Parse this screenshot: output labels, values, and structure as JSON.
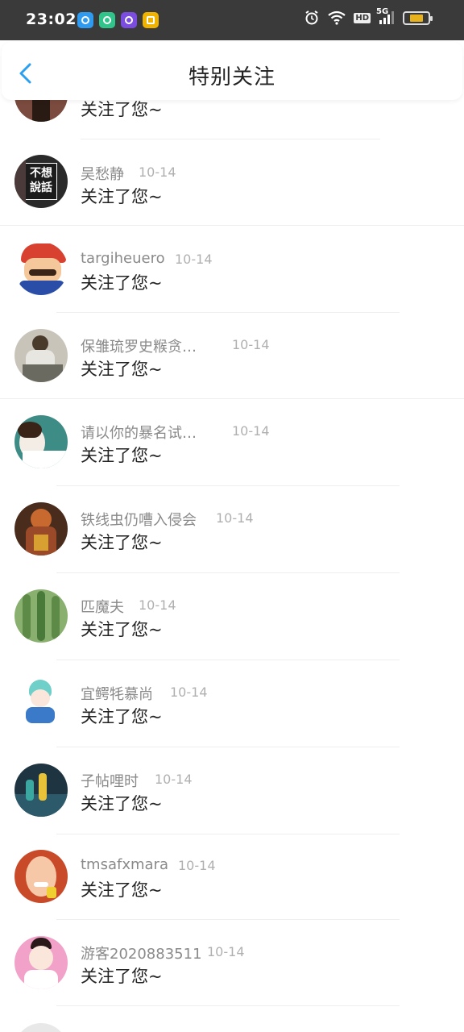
{
  "status_bar": {
    "time": "23:02",
    "network": "5G",
    "hd_label": "HD",
    "battery_level": 0.6,
    "app_icons": [
      {
        "name": "browser-app-icon",
        "color": "#2f9bf0"
      },
      {
        "name": "camera-app-icon",
        "color": "#2fc58a"
      },
      {
        "name": "chat-app-icon",
        "color": "#7b4ce0"
      },
      {
        "name": "wallet-app-icon",
        "color": "#f0b400"
      }
    ]
  },
  "header": {
    "title": "特别关注",
    "accent_color": "#2b9ff0"
  },
  "items": [
    {
      "name": "",
      "date": "",
      "message": "关注了您~",
      "avatar_color": "#7a4b3e"
    },
    {
      "name": "吴愁静",
      "date": "10-14",
      "message": "关注了您~",
      "avatar_color": "#2a2a2a",
      "avatar_text": "不想\n說話"
    },
    {
      "name": "targiheuero",
      "date": "10-14",
      "message": "关注了您~",
      "avatar_color": "#d8402f"
    },
    {
      "name": "保雏琉罗史糇贪…",
      "date": "10-14",
      "message": "关注了您~",
      "avatar_color": "#8c8c84"
    },
    {
      "name": "请以你的暴名试…",
      "date": "10-14",
      "message": "关注了您~",
      "avatar_color": "#3e8c86"
    },
    {
      "name": "铁线虫仍嘈入侵会",
      "date": "10-14",
      "message": "关注了您~",
      "avatar_color": "#9a4a28"
    },
    {
      "name": "匹魔夫",
      "date": "10-14",
      "message": "关注了您~",
      "avatar_color": "#6e9a5a"
    },
    {
      "name": "宜鳄牦慕尚",
      "date": "10-14",
      "message": "关注了您~",
      "avatar_color": "#6ed0c8"
    },
    {
      "name": "子帖哩时",
      "date": "10-14",
      "message": "关注了您~",
      "avatar_color": "#2c4a5a"
    },
    {
      "name": "tmsafxmara",
      "date": "10-14",
      "message": "关注了您~",
      "avatar_color": "#e0704a"
    },
    {
      "name": "游客2020883511",
      "date": "10-14",
      "message": "关注了您~",
      "avatar_color": "#f2a2c8"
    },
    {
      "name": "",
      "date": "",
      "message": "",
      "avatar_color": "#e8e8e8"
    }
  ]
}
